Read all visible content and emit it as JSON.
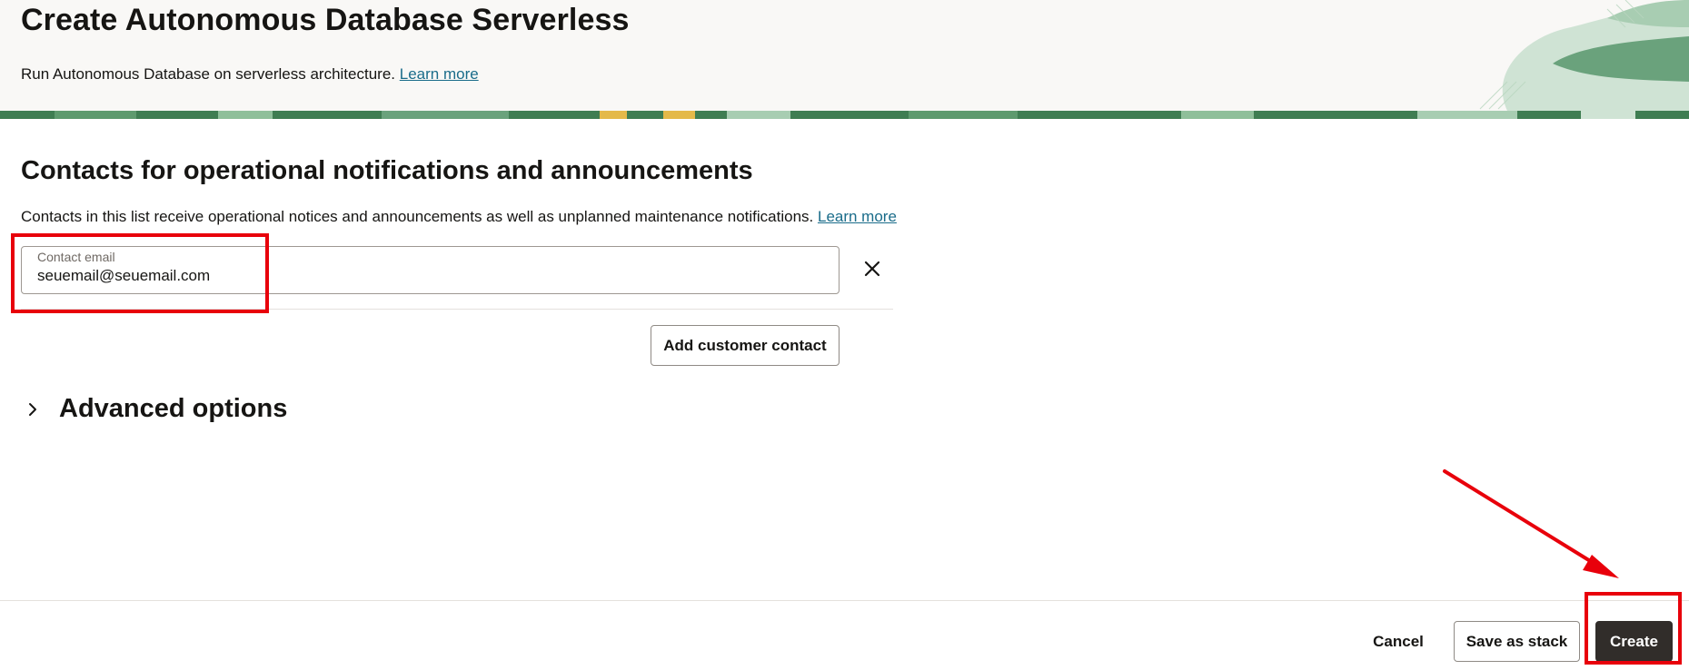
{
  "header": {
    "title": "Create Autonomous Database Serverless",
    "subtitle": "Run Autonomous Database on serverless architecture.",
    "learn_more": "Learn more"
  },
  "contacts": {
    "title": "Contacts for operational notifications and announcements",
    "description": "Contacts in this list receive operational notices and announcements as well as unplanned maintenance notifications.",
    "learn_more": "Learn more",
    "email_label": "Contact email",
    "email_value": "seuemail@seuemail.com",
    "add_contact_label": "Add customer contact"
  },
  "advanced": {
    "label": "Advanced options"
  },
  "footer": {
    "cancel_label": "Cancel",
    "save_stack_label": "Save as stack",
    "create_label": "Create"
  },
  "colors": {
    "primary_button": "#312d2a",
    "link": "#1a6c8a",
    "annotation": "#e8000b",
    "header_band": "#3f7d52"
  },
  "icons": {
    "remove": "close-icon",
    "expand": "chevron-right-icon"
  }
}
